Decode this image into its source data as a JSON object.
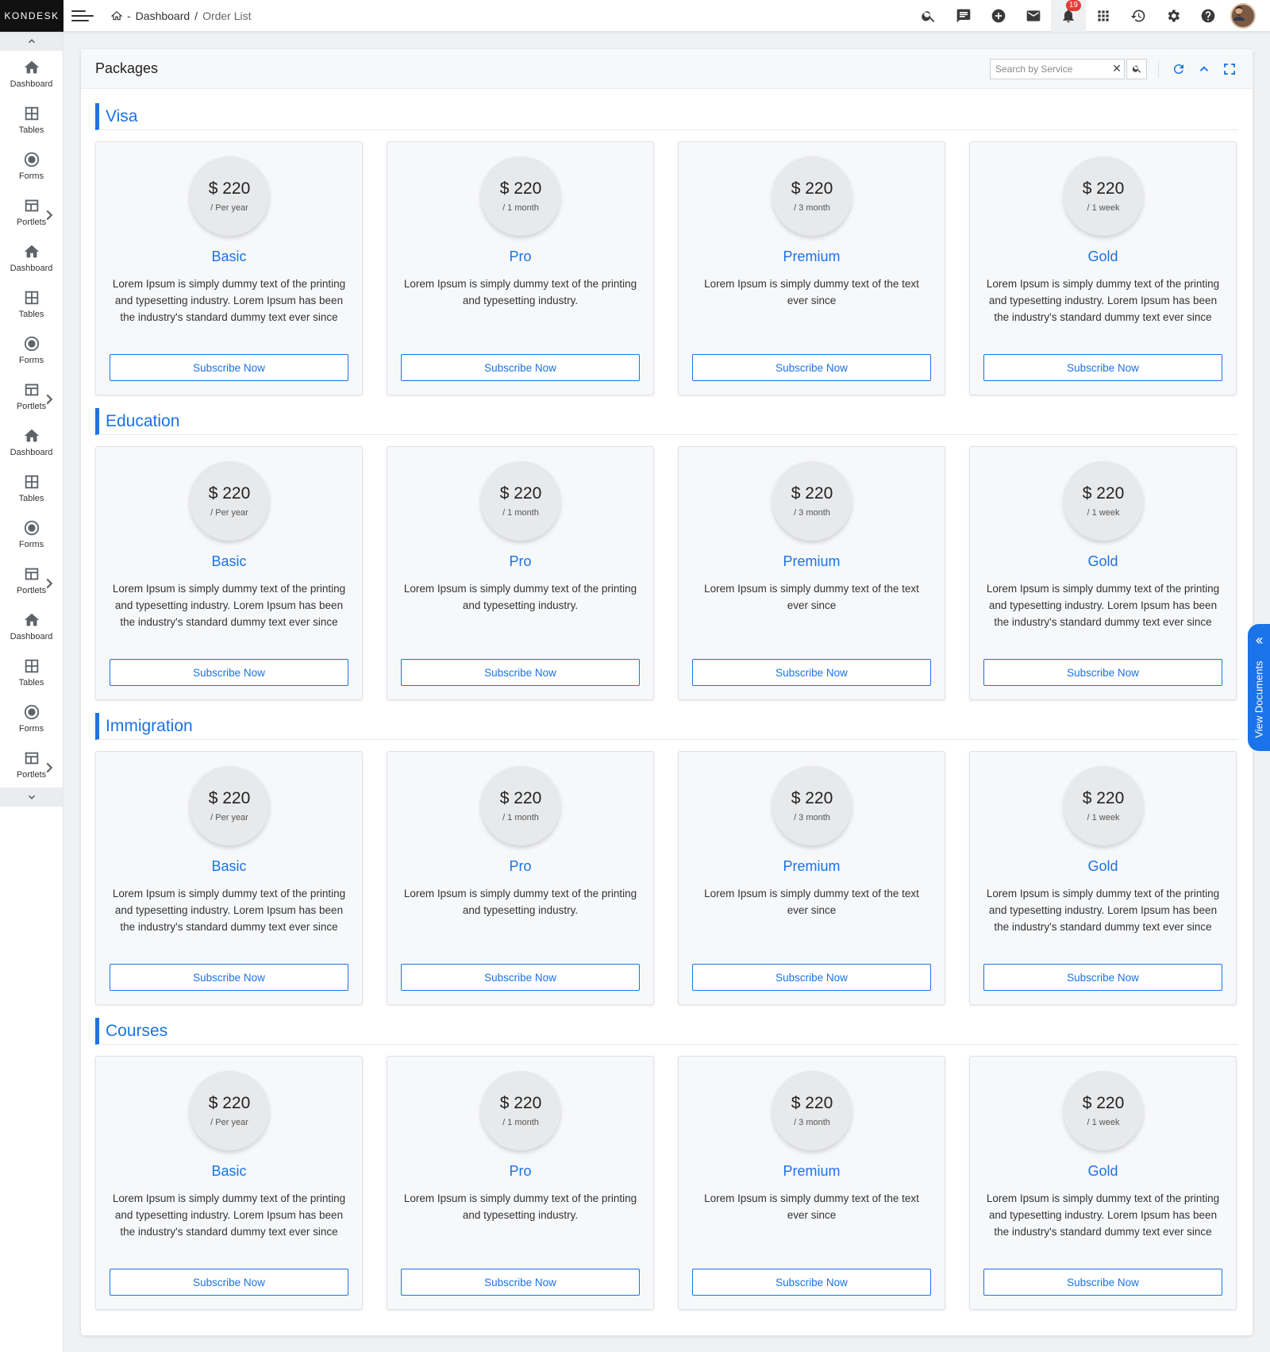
{
  "brand": "KONDESK",
  "breadcrumb": {
    "separator_dash": "-",
    "home": "Dashboard",
    "separator": "/",
    "current": "Order List"
  },
  "header": {
    "notification_count": "19"
  },
  "sidebar": {
    "items": [
      {
        "label": "Dashboard",
        "icon": "home-icon"
      },
      {
        "label": "Tables",
        "icon": "table-icon"
      },
      {
        "label": "Forms",
        "icon": "radio-icon"
      },
      {
        "label": "Portlets",
        "icon": "portlet-icon"
      },
      {
        "label": "Dashboard",
        "icon": "home-icon"
      },
      {
        "label": "Tables",
        "icon": "table-icon"
      },
      {
        "label": "Forms",
        "icon": "radio-icon"
      },
      {
        "label": "Portlets",
        "icon": "portlet-icon"
      },
      {
        "label": "Dashboard",
        "icon": "home-icon"
      },
      {
        "label": "Tables",
        "icon": "table-icon"
      },
      {
        "label": "Forms",
        "icon": "radio-icon"
      },
      {
        "label": "Portlets",
        "icon": "portlet-icon"
      },
      {
        "label": "Dashboard",
        "icon": "home-icon"
      },
      {
        "label": "Tables",
        "icon": "table-icon"
      },
      {
        "label": "Forms",
        "icon": "radio-icon"
      },
      {
        "label": "Portlets",
        "icon": "portlet-icon"
      }
    ]
  },
  "panel": {
    "title": "Packages",
    "search_placeholder": "Search by Service",
    "clear_label": "✕"
  },
  "sections": [
    {
      "title": "Visa"
    },
    {
      "title": "Education"
    },
    {
      "title": "Immigration"
    },
    {
      "title": "Courses"
    }
  ],
  "plans": [
    {
      "price": "$ 220",
      "period": "/ Per year",
      "name": "Basic",
      "description": "Lorem Ipsum is simply dummy text of the printing and typesetting industry. Lorem Ipsum has been the industry's standard dummy text ever since",
      "button": "Subscribe Now"
    },
    {
      "price": "$ 220",
      "period": "/ 1 month",
      "name": "Pro",
      "description": "Lorem Ipsum is simply dummy text of the printing and typesetting industry.",
      "button": "Subscribe Now"
    },
    {
      "price": "$ 220",
      "period": "/ 3 month",
      "name": "Premium",
      "description": "Lorem Ipsum is simply dummy text of the text ever since",
      "button": "Subscribe Now"
    },
    {
      "price": "$ 220",
      "period": "/ 1 week",
      "name": "Gold",
      "description": "Lorem Ipsum is simply dummy text of the printing and typesetting industry. Lorem Ipsum has been the industry's standard dummy text ever since",
      "button": "Subscribe Now"
    }
  ],
  "view_documents": "View Documents",
  "colors": {
    "accent": "#1a73e8",
    "badge": "#e53935",
    "brand_bg": "#111111"
  }
}
